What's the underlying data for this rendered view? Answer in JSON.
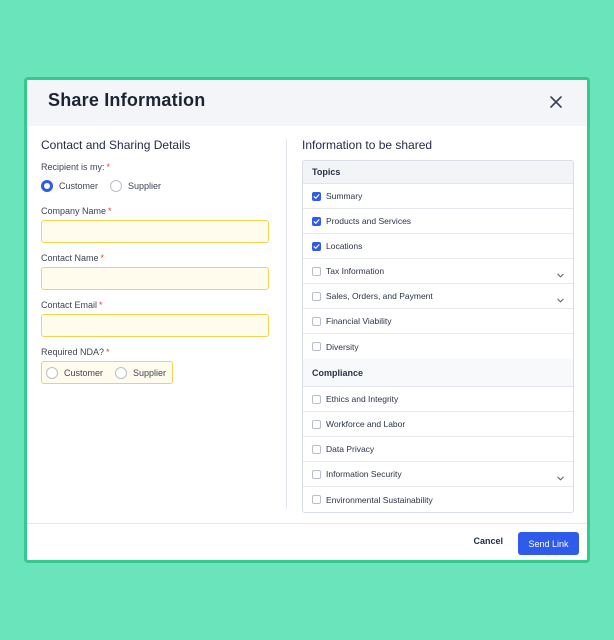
{
  "dialog": {
    "title": "Share Information",
    "close_icon": "close-icon"
  },
  "left": {
    "section_title": "Contact and Sharing Details",
    "recipient_label": "Recipient is my:",
    "recipient_options": [
      {
        "label": "Customer",
        "checked": true
      },
      {
        "label": "Supplier",
        "checked": false
      }
    ],
    "company_name_label": "Company Name",
    "company_name_value": "",
    "contact_name_label": "Contact Name",
    "contact_name_value": "",
    "contact_email_label": "Contact Email",
    "contact_email_value": "",
    "nda_label": "Required NDA?",
    "nda_options": [
      {
        "label": "Customer",
        "checked": false
      },
      {
        "label": "Supplier",
        "checked": false
      }
    ],
    "required_marker": "*"
  },
  "right": {
    "section_title": "Information to be shared",
    "topics_header": "Topics",
    "topics": [
      {
        "label": "Summary",
        "checked": true,
        "expandable": false
      },
      {
        "label": "Products and Services",
        "checked": true,
        "expandable": false
      },
      {
        "label": "Locations",
        "checked": true,
        "expandable": false
      },
      {
        "label": "Tax Information",
        "checked": false,
        "expandable": true
      },
      {
        "label": "Sales, Orders, and Payment",
        "checked": false,
        "expandable": true
      },
      {
        "label": "Financial Viability",
        "checked": false,
        "expandable": false
      },
      {
        "label": "Diversity",
        "checked": false,
        "expandable": false
      }
    ],
    "compliance_header": "Compliance",
    "compliance": [
      {
        "label": " Ethics and Integrity",
        "checked": false,
        "expandable": false
      },
      {
        "label": "Workforce and Labor",
        "checked": false,
        "expandable": false
      },
      {
        "label": "Data Privacy",
        "checked": false,
        "expandable": false
      },
      {
        "label": "Information Security",
        "checked": false,
        "expandable": true
      },
      {
        "label": "Environmental Sustainability",
        "checked": false,
        "expandable": false
      }
    ]
  },
  "footer": {
    "cancel_label": "Cancel",
    "send_label": "Send Link"
  },
  "colors": {
    "background": "#6ae4bb",
    "dialog_border": "#35c98f",
    "accent": "#2f5bea",
    "required": "#e0413a",
    "input_fill": "#fffcee",
    "input_border": "#f2d44f"
  }
}
